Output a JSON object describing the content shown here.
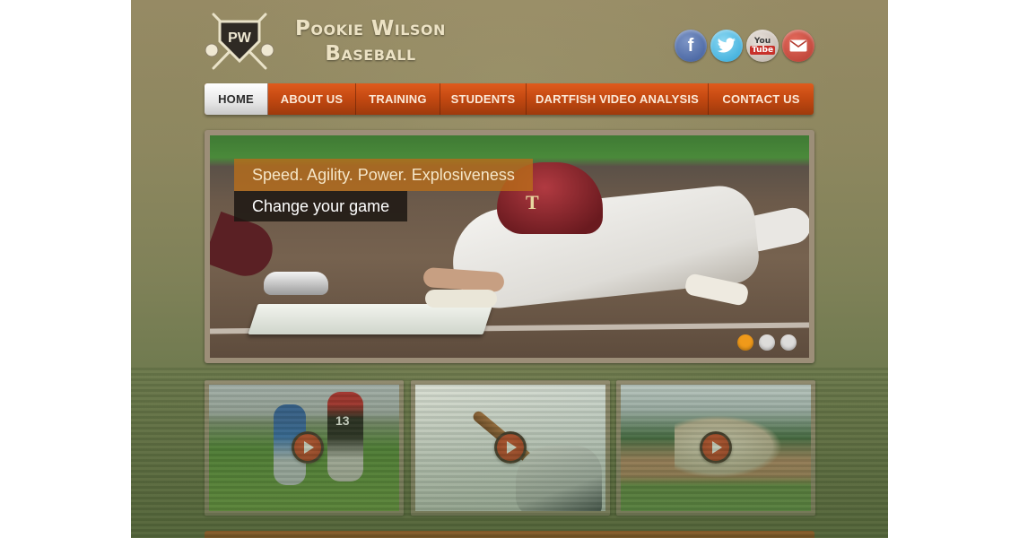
{
  "brand": {
    "logo_initials": "PW",
    "name_line1": "Pookie Wilson",
    "name_line2": "Baseball"
  },
  "social": {
    "facebook_glyph": "f",
    "youtube_you": "You",
    "youtube_tube": "Tube",
    "icons": [
      "facebook-icon",
      "twitter-icon",
      "youtube-icon",
      "email-icon"
    ]
  },
  "nav": {
    "items": [
      {
        "label": "HOME",
        "active": true
      },
      {
        "label": "ABOUT US"
      },
      {
        "label": "TRAINING"
      },
      {
        "label": "STUDENTS"
      },
      {
        "label": "DARTFISH VIDEO ANALYSIS"
      },
      {
        "label": "CONTACT US"
      }
    ]
  },
  "slider": {
    "caption_line1": "Speed. Agility. Power. Explosiveness",
    "caption_line2": "Change your game",
    "helmet_letter": "T",
    "dots": 3,
    "active_dot": 1
  },
  "thumbnails": {
    "jersey_number": "13",
    "play_icon": "play-icon"
  },
  "colors": {
    "accent": "#c24811",
    "active_dot": "#f09a1a",
    "play_button": "#c63c20"
  }
}
